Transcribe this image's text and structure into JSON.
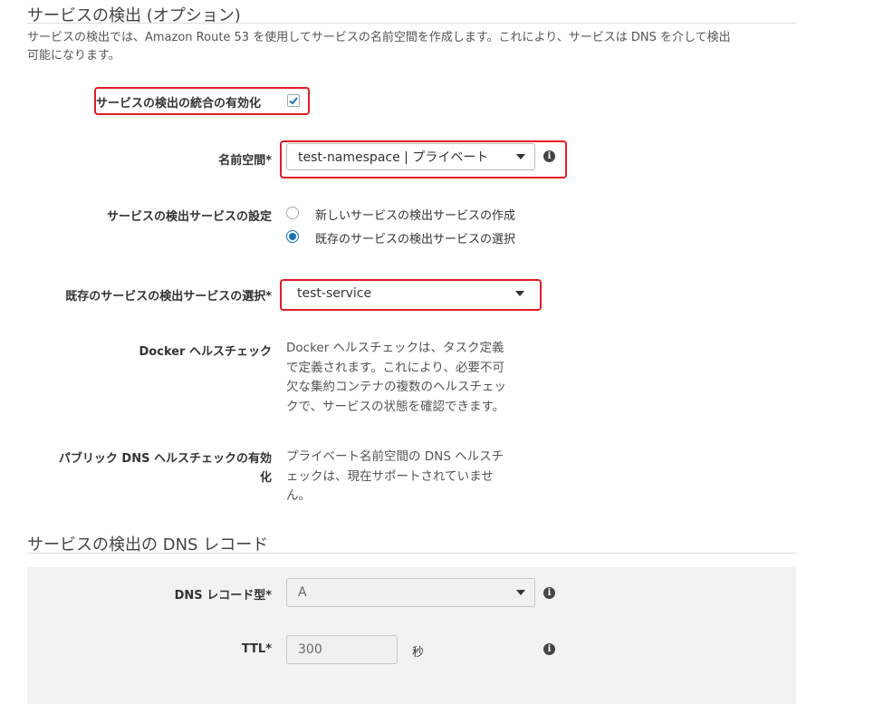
{
  "section1": {
    "title": "サービスの検出 (オプション)",
    "description_line1": "サービスの検出では、Amazon Route 53 を使用してサービスの名前空間を作成します。これにより、サービスは DNS を介して検出",
    "description_line2": "可能になります。"
  },
  "enable_integration": {
    "label": "サービスの検出の統合の有効化",
    "checked": true
  },
  "namespace": {
    "label": "名前空間*",
    "value": "test-namespace | プライベート"
  },
  "service_config": {
    "label": "サービスの検出サービスの設定",
    "options": [
      "新しいサービスの検出サービスの作成",
      "既存のサービスの検出サービスの選択"
    ],
    "selected_index": 1
  },
  "existing_service": {
    "label": "既存のサービスの検出サービスの選択*",
    "value": "test-service"
  },
  "docker_health": {
    "label": "Docker ヘルスチェック",
    "text_lines": [
      "Docker ヘルスチェックは、タスク定義",
      "で定義されます。これにより、必要不可",
      "欠な集約コンテナの複数のヘルスチェッ",
      "クで、サービスの状態を確認できます。"
    ]
  },
  "public_dns_health": {
    "label_line1": "パブリック DNS ヘルスチェックの有効",
    "label_line2": "化",
    "text_lines": [
      "プライベート名前空間の DNS ヘルスチ",
      "ェックは、現在サポートされていませ",
      "ん。"
    ]
  },
  "section2": {
    "title": "サービスの検出の DNS レコード"
  },
  "dns_record_type": {
    "label": "DNS レコード型*",
    "value": "A"
  },
  "ttl": {
    "label": "TTL*",
    "value": "300",
    "unit": "秒"
  },
  "icons": {
    "info": "info-icon",
    "check": "check-icon",
    "caret": "caret-down-icon"
  },
  "colors": {
    "highlight": "#e21b24",
    "accent": "#1a73b5"
  }
}
